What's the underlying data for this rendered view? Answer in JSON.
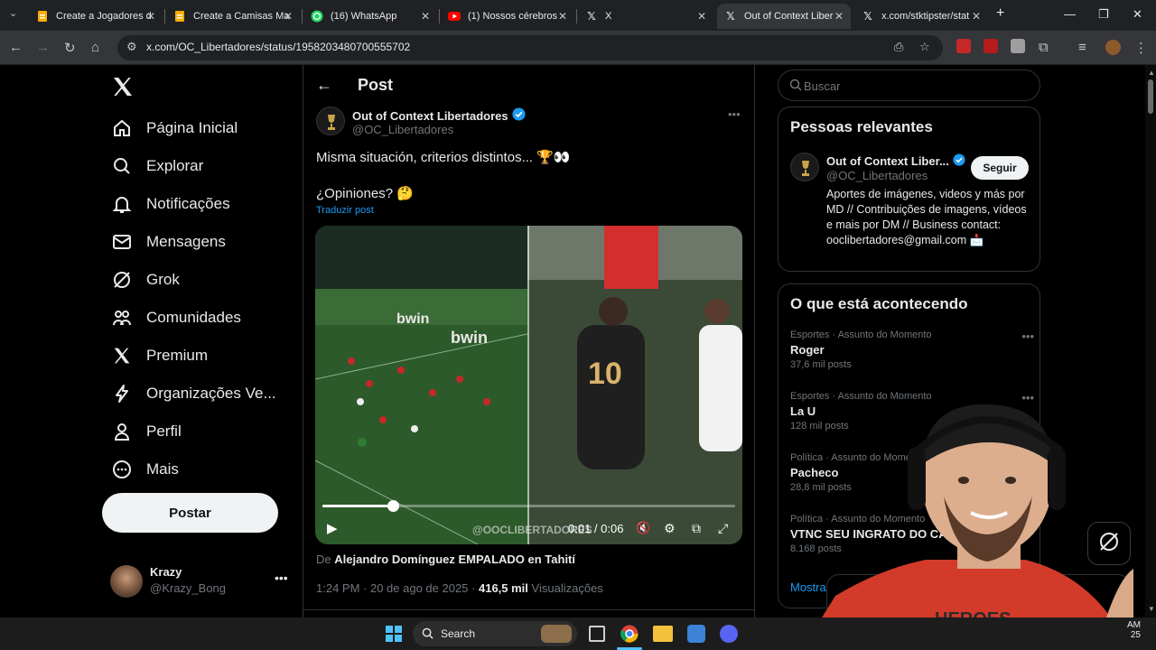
{
  "browser": {
    "tabs": [
      {
        "title": "Create a Jogadores d",
        "icon": "sheets-icon",
        "color": "#f9ab00"
      },
      {
        "title": "Create a Camisas Ma",
        "icon": "sheets-icon",
        "color": "#f9ab00"
      },
      {
        "title": "(16) WhatsApp",
        "icon": "whatsapp-icon",
        "color": "#25d366"
      },
      {
        "title": "(1) Nossos cérebros",
        "icon": "youtube-icon",
        "color": "#ff0000"
      },
      {
        "title": "X",
        "icon": "x-icon",
        "color": "#e8eaed"
      },
      {
        "title": "Out of Context Liber",
        "icon": "x-icon",
        "color": "#e8eaed"
      },
      {
        "title": "x.com/stktipster/stat",
        "icon": "x-icon",
        "color": "#e8eaed"
      }
    ],
    "url": "x.com/OC_Libertadores/status/1958203480700555702"
  },
  "nav": {
    "items": [
      {
        "label": "Página Inicial",
        "icon": "home-icon"
      },
      {
        "label": "Explorar",
        "icon": "search-icon"
      },
      {
        "label": "Notificações",
        "icon": "bell-icon"
      },
      {
        "label": "Mensagens",
        "icon": "mail-icon"
      },
      {
        "label": "Grok",
        "icon": "grok-icon"
      },
      {
        "label": "Comunidades",
        "icon": "communities-icon"
      },
      {
        "label": "Premium",
        "icon": "x-icon"
      },
      {
        "label": "Organizações Ve...",
        "icon": "lightning-icon"
      },
      {
        "label": "Perfil",
        "icon": "person-icon"
      },
      {
        "label": "Mais",
        "icon": "more-circle-icon"
      }
    ],
    "post_label": "Postar",
    "me": {
      "name": "Krazy",
      "handle": "@Krazy_Bong"
    }
  },
  "post": {
    "header": "Post",
    "author": "Out of Context Libertadores",
    "handle": "@OC_Libertadores",
    "line1": "Misma situación, criterios distintos... 🏆👀",
    "line2": "¿Opiniones? 🤔",
    "translate": "Traduzir post",
    "video": {
      "time": "0:01 / 0:06",
      "watermark": "@OOCLIBERTADORES",
      "progress": 0.17
    },
    "from_prefix": "De",
    "from_title": "Alejandro Domínguez EMPALADO en Tahití",
    "timestamp": "1:24 PM · 20 de ago de 2025 ·",
    "views_count": "416,5 mil",
    "views_label": "Visualizações"
  },
  "sidebar": {
    "search_placeholder": "Buscar",
    "relevant": {
      "title": "Pessoas relevantes",
      "name": "Out of Context Liber...",
      "handle": "@OC_Libertadores",
      "follow": "Seguir",
      "bio": "Aportes de imágenes, videos y más por MD // Contribuições de imagens, vídeos e mais por DM // Business contact: ooclibertadores@gmail.com 📩"
    },
    "trending": {
      "title": "O que está acontecendo",
      "items": [
        {
          "category": "Esportes · Assunto do Momento",
          "name": "Roger",
          "count": "37,6 mil posts"
        },
        {
          "category": "Esportes · Assunto do Momento",
          "name": "La U",
          "count": "128 mil posts"
        },
        {
          "category": "Política · Assunto do Momento",
          "name": "Pacheco",
          "count": "28,8 mil posts"
        },
        {
          "category": "Política · Assunto do Momento",
          "name": "VTNC SEU INGRATO DO CA",
          "count": "8.168 posts"
        }
      ],
      "show_more": "Mostrar"
    }
  },
  "taskbar": {
    "search": "Search",
    "clock_time": "AM",
    "clock_date": "25"
  },
  "webcam_shirt": "HEROES"
}
